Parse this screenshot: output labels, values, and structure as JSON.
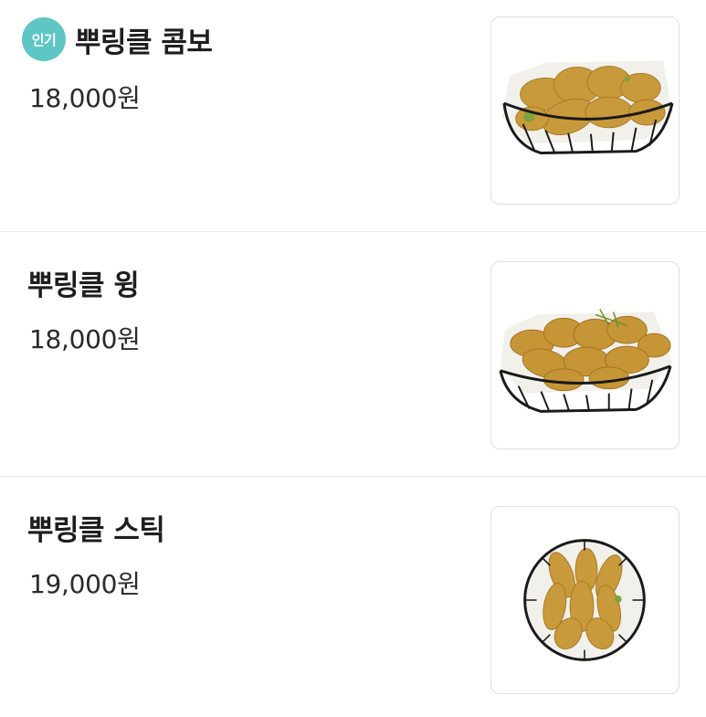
{
  "menu": {
    "items": [
      {
        "badge": "인기",
        "name": "뿌링클 콤보",
        "price": "18,000원",
        "image": "fried-chicken-combo-basket-image"
      },
      {
        "badge": "",
        "name": "뿌링클 윙",
        "price": "18,000원",
        "image": "fried-chicken-wing-basket-image"
      },
      {
        "badge": "",
        "name": "뿌링클 스틱",
        "price": "19,000원",
        "image": "fried-chicken-stick-basket-image"
      }
    ]
  },
  "colors": {
    "badge": "#5ec6c4",
    "chicken": "#c89a3a",
    "basket": "#1a1a1a"
  }
}
